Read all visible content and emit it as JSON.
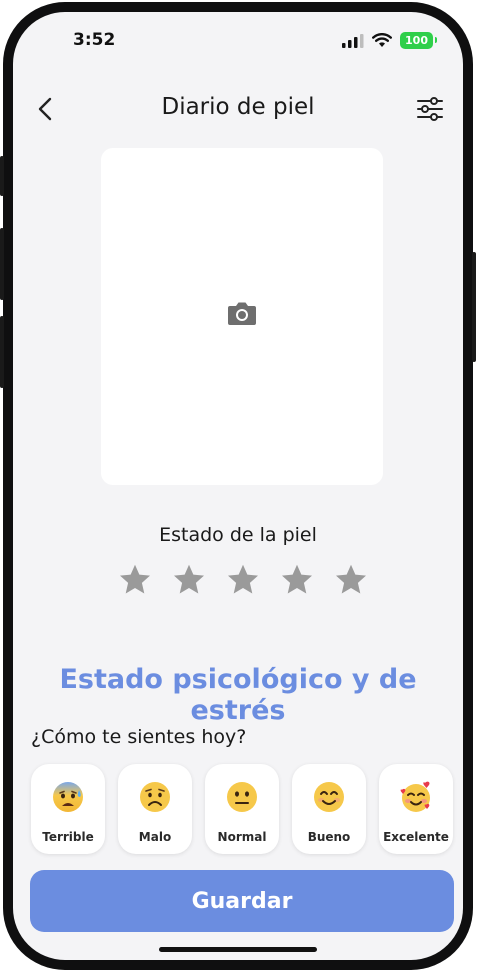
{
  "status": {
    "time": "3:52",
    "battery": "100"
  },
  "header": {
    "title": "Diario de piel",
    "back_icon": "chevron-left-icon",
    "filter_icon": "sliders-icon"
  },
  "photo": {
    "icon": "camera-icon"
  },
  "skin": {
    "label": "Estado de la piel",
    "rating": 0,
    "max": 5
  },
  "psych": {
    "title": "Estado psicológico y de estrés",
    "question": "¿Cómo te sientes hoy?",
    "moods": [
      {
        "label": "Terrible",
        "icon": "anxious-sweat-face-icon"
      },
      {
        "label": "Malo",
        "icon": "worried-face-icon"
      },
      {
        "label": "Normal",
        "icon": "neutral-face-icon"
      },
      {
        "label": "Bueno",
        "icon": "smiling-face-icon"
      },
      {
        "label": "Excelente",
        "icon": "hearts-face-icon"
      }
    ]
  },
  "actions": {
    "save_label": "Guardar"
  },
  "colors": {
    "accent": "#6b8de0",
    "star": "#9a9a9a",
    "battery": "#2fcf4a"
  }
}
